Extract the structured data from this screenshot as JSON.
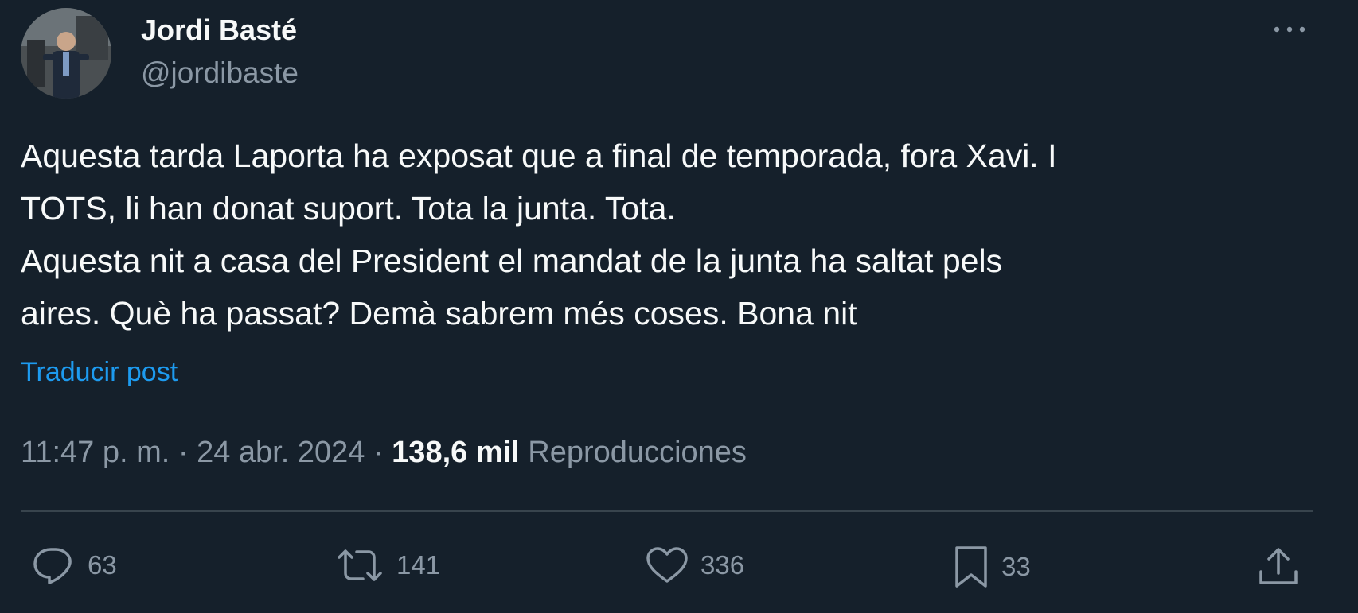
{
  "author": {
    "display_name": "Jordi Basté",
    "handle": "@jordibaste"
  },
  "tweet": {
    "lines": [
      "Aquesta tarda Laporta ha exposat que a final de temporada, fora Xavi. I",
      "TOTS, li han donat suport. Tota la junta. Tota.",
      "Aquesta nit a casa del President el mandat de la junta ha saltat pels",
      "aires. Què ha passat? Demà sabrem més coses. Bona nit"
    ],
    "translate_label": "Traducir post"
  },
  "meta": {
    "time": "11:47 p. m.",
    "separator": "·",
    "date": "24 abr. 2024",
    "views_count": "138,6 mil",
    "views_label": "Reproducciones"
  },
  "actions": {
    "replies": "63",
    "reposts": "141",
    "likes": "336",
    "bookmarks": "33"
  },
  "icons": {
    "more": "more-horizontal-icon",
    "reply": "reply-icon",
    "repost": "repost-icon",
    "like": "heart-icon",
    "bookmark": "bookmark-icon",
    "share": "share-icon"
  },
  "colors": {
    "background": "#15202b",
    "text_primary": "#f7f9f9",
    "text_secondary": "#8b98a5",
    "link": "#1d9bf0",
    "divider": "#38444d"
  }
}
